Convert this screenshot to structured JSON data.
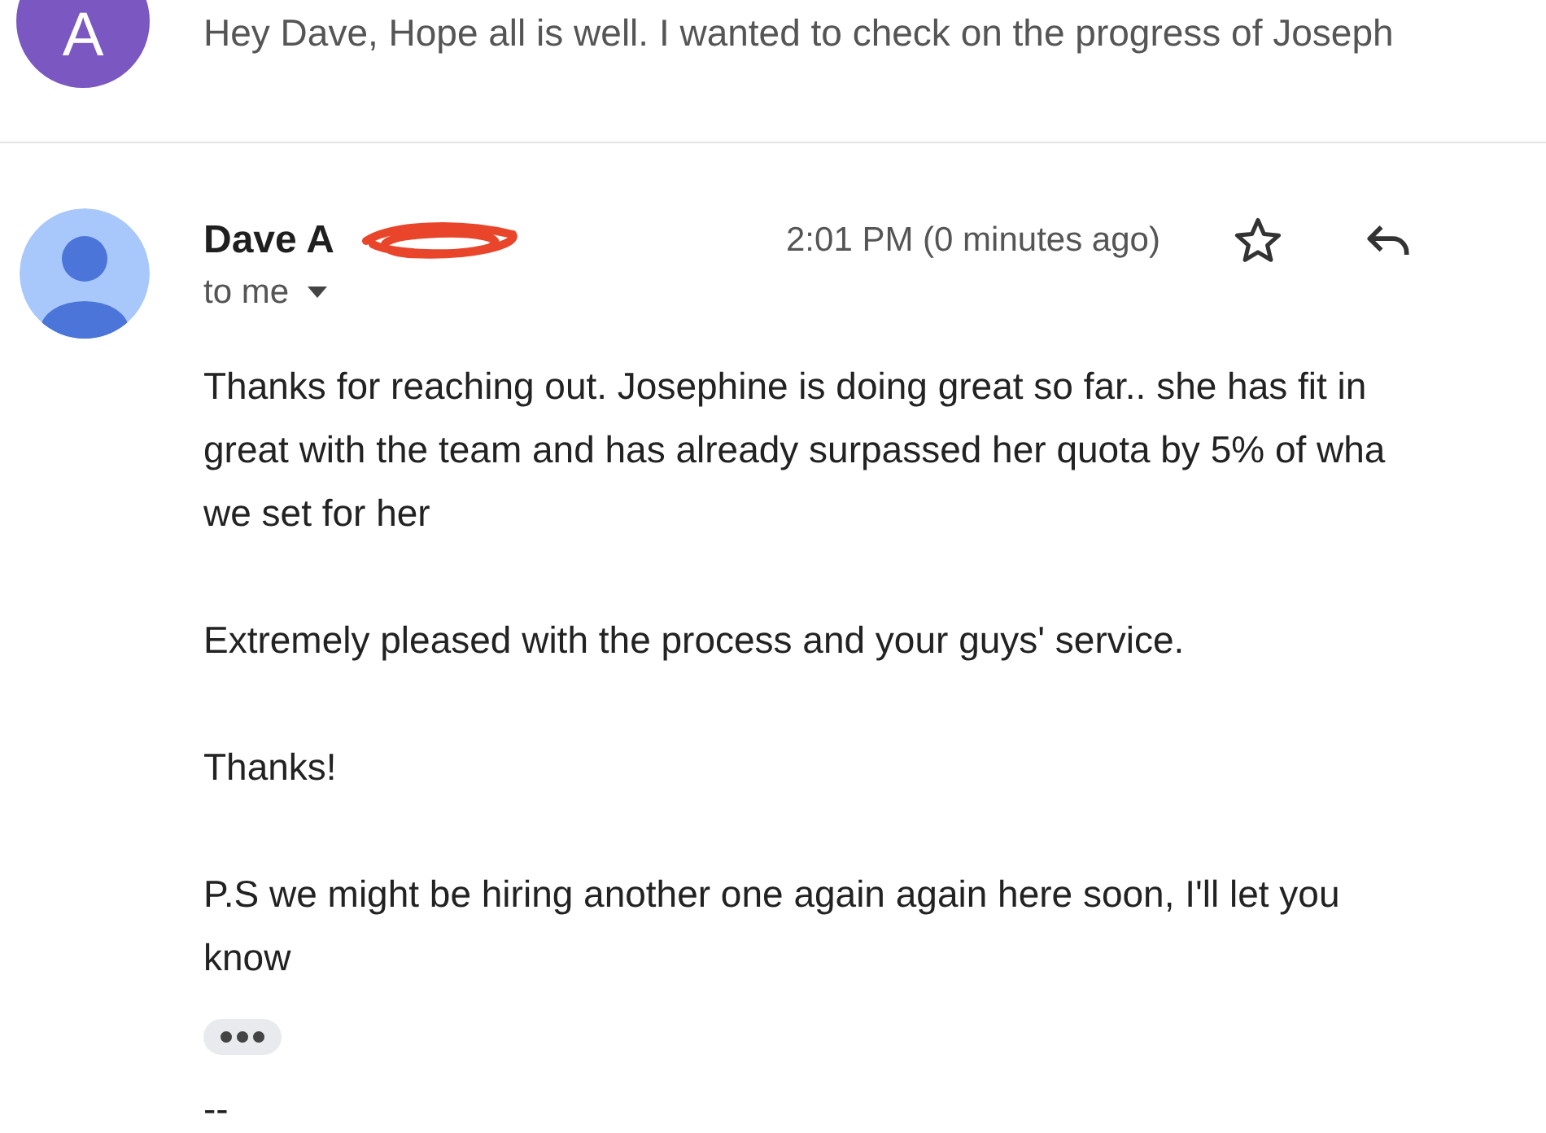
{
  "previous_message": {
    "avatar_letter": "A",
    "snippet": "Hey Dave, Hope all is well. I wanted to check on the progress of Joseph"
  },
  "message": {
    "sender": "Dave A",
    "time": "2:01 PM (0 minutes ago)",
    "recipient": "to me",
    "starred": false,
    "body": [
      {
        "lines": [
          "Thanks for reaching out. Josephine is doing great so far.. she has fit in",
          "great with the team and has already surpassed her quota by 5% of wha",
          "we set for her"
        ]
      },
      {
        "lines": [
          "Extremely pleased with the process and your guys' service."
        ]
      },
      {
        "lines": [
          "Thanks!"
        ]
      },
      {
        "lines": [
          "P.S we might be hiring another one again again here soon, I'll let you",
          "know"
        ]
      }
    ],
    "signature": "--"
  }
}
